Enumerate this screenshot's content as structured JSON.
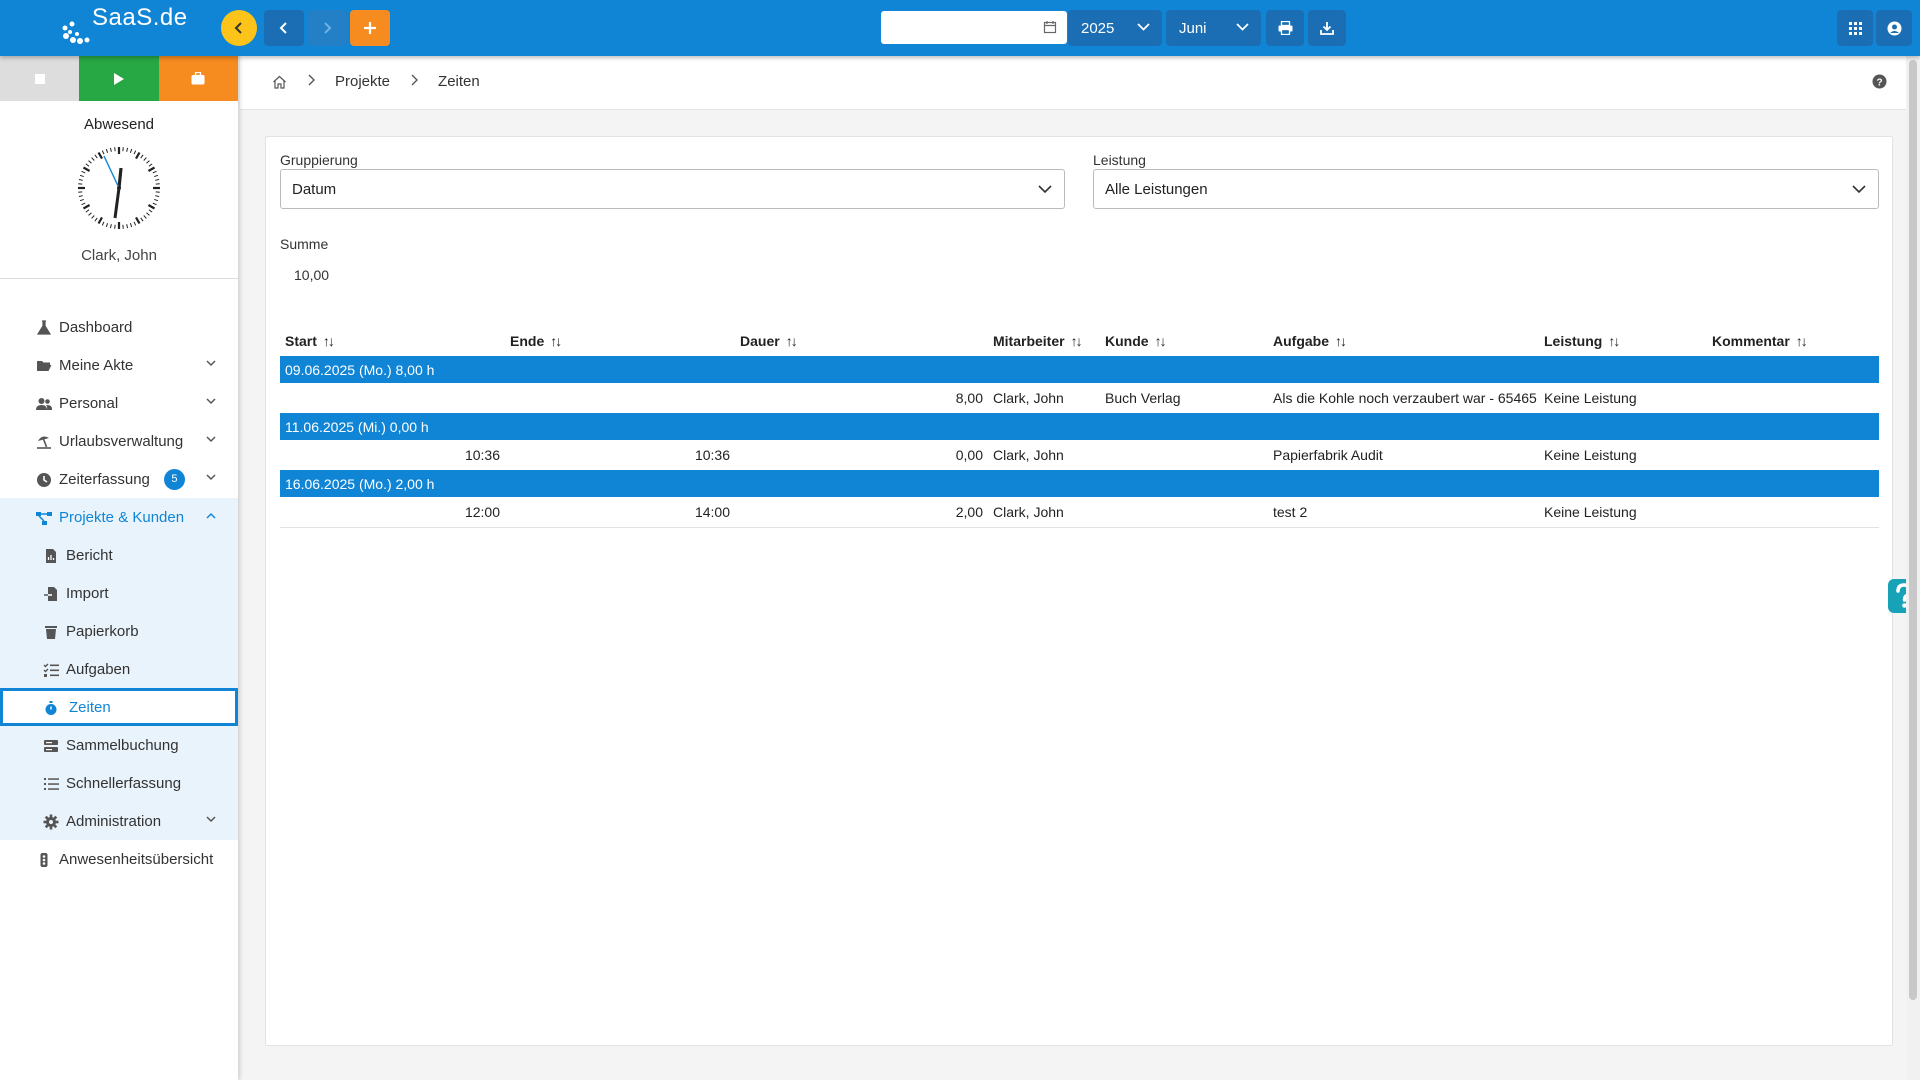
{
  "topbar": {
    "logo": "SaaS.de",
    "year": "2025",
    "month": "Juni",
    "date_value": ""
  },
  "sidebar": {
    "status": "Abwesend",
    "user": "Clark, John",
    "items": [
      {
        "label": "Dashboard"
      },
      {
        "label": "Meine Akte"
      },
      {
        "label": "Personal"
      },
      {
        "label": "Urlaubsverwaltung"
      },
      {
        "label": "Zeiterfassung",
        "badge": "5"
      },
      {
        "label": "Projekte & Kunden"
      }
    ],
    "sub_items": [
      {
        "label": "Bericht"
      },
      {
        "label": "Import"
      },
      {
        "label": "Papierkorb"
      },
      {
        "label": "Aufgaben"
      },
      {
        "label": "Zeiten"
      },
      {
        "label": "Sammelbuchung"
      },
      {
        "label": "Schnellerfassung"
      },
      {
        "label": "Administration"
      }
    ],
    "last_item": "Anwesenheitsübersicht"
  },
  "breadcrumb": [
    "Projekte",
    "Zeiten"
  ],
  "filters": {
    "grouping_label": "Gruppierung",
    "grouping_value": "Datum",
    "service_label": "Leistung",
    "service_value": "Alle Leistungen"
  },
  "summary": {
    "label": "Summe",
    "value": "10,00"
  },
  "table": {
    "headers": [
      "Start",
      "Ende",
      "Dauer",
      "Mitarbeiter",
      "Kunde",
      "Aufgabe",
      "Leistung",
      "Kommentar"
    ],
    "groups": [
      {
        "title": "09.06.2025 (Mo.) 8,00 h",
        "rows": [
          {
            "start": "",
            "end": "",
            "duration": "8,00",
            "employee": "Clark, John",
            "customer": "Buch Verlag",
            "task": "Als die Kohle noch verzaubert war - 65465",
            "service": "Keine Leistung",
            "comment": ""
          }
        ]
      },
      {
        "title": "11.06.2025 (Mi.) 0,00 h",
        "rows": [
          {
            "start": "10:36",
            "end": "10:36",
            "duration": "0,00",
            "employee": "Clark, John",
            "customer": "",
            "task": "Papierfabrik Audit",
            "service": "Keine Leistung",
            "comment": ""
          }
        ]
      },
      {
        "title": "16.06.2025 (Mo.) 2,00 h",
        "rows": [
          {
            "start": "12:00",
            "end": "14:00",
            "duration": "2,00",
            "employee": "Clark, John",
            "customer": "",
            "task": "test 2",
            "service": "Keine Leistung",
            "comment": ""
          }
        ]
      }
    ]
  },
  "colors": {
    "primary": "#1185d5",
    "accent_orange": "#f68b1f",
    "accent_green": "#28a745",
    "accent_yellow": "#fcc419"
  }
}
